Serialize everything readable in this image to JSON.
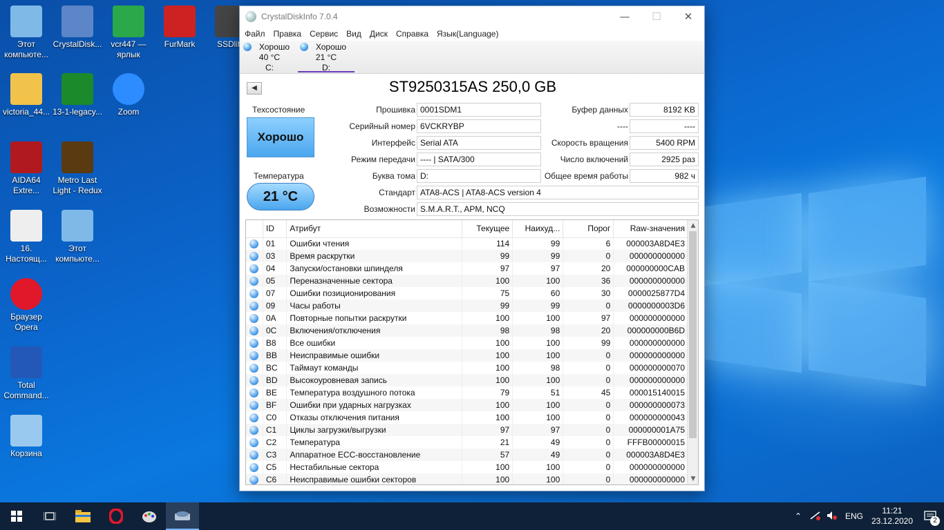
{
  "desktop": {
    "icons": [
      {
        "label": "Этот компьюте...",
        "icon": "computer-icon"
      },
      {
        "label": "CrystalDisk...",
        "icon": "crystaldisk-icon"
      },
      {
        "label": "vcr447 — ярлык",
        "icon": "vcr-icon"
      },
      {
        "label": "FurMark",
        "icon": "furmark-icon"
      },
      {
        "label": "SSDlife",
        "icon": "ssdlife-icon"
      },
      {
        "label": "victoria_44...",
        "icon": "folder-icon"
      },
      {
        "label": "13-1-legacy...",
        "icon": "amd-icon"
      },
      {
        "label": "Zoom",
        "icon": "zoom-icon"
      },
      {
        "label": "AIDA64 Extre...",
        "icon": "aida64-icon"
      },
      {
        "label": "Metro Last Light - Redux",
        "icon": "metro-icon"
      },
      {
        "label": "16. Настоящ...",
        "icon": "audio-file-icon"
      },
      {
        "label": "Этот компьюте...",
        "icon": "computer-icon"
      },
      {
        "label": "Браузер Opera",
        "icon": "opera-icon"
      },
      {
        "label": "Total Command...",
        "icon": "total-commander-icon"
      },
      {
        "label": "Корзина",
        "icon": "recycle-bin-icon"
      }
    ]
  },
  "window": {
    "title": "CrystalDiskInfo 7.0.4",
    "menu": [
      "Файл",
      "Правка",
      "Сервис",
      "Вид",
      "Диск",
      "Справка",
      "Язык(Language)"
    ],
    "disks": [
      {
        "status": "Хорошо",
        "temp": "40 °C",
        "letter": "C:"
      },
      {
        "status": "Хорошо",
        "temp": "21 °C",
        "letter": "D:"
      }
    ],
    "model": "ST9250315AS 250,0 GB",
    "health_label": "Техсостояние",
    "health_value": "Хорошо",
    "temp_label": "Температура",
    "temp_value": "21 °C",
    "fields": {
      "firmware_label": "Прошивка",
      "firmware": "0001SDM1",
      "serial_label": "Серийный номер",
      "serial": "6VCKRYBP",
      "interface_label": "Интерфейс",
      "interface": "Serial ATA",
      "transfer_label": "Режим передачи",
      "transfer": "---- | SATA/300",
      "letter_label": "Буква тома",
      "letter": "D:",
      "standard_label": "Стандарт",
      "standard": "ATA8-ACS | ATA8-ACS version 4",
      "features_label": "Возможности",
      "features": "S.M.A.R.T., APM, NCQ",
      "buffer_label": "Буфер данных",
      "buffer": "8192 KB",
      "blank_label": "----",
      "blank": "----",
      "rpm_label": "Скорость вращения",
      "rpm": "5400 RPM",
      "power_count_label": "Число включений",
      "power_count": "2925 раз",
      "power_hours_label": "Общее время работы",
      "power_hours": "982 ч"
    },
    "table": {
      "headers": [
        "ID",
        "Атрибут",
        "Текущее",
        "Наихуд...",
        "Порог",
        "Raw-значения"
      ],
      "rows": [
        [
          "01",
          "Ошибки чтения",
          "114",
          "99",
          "6",
          "000003A8D4E3"
        ],
        [
          "03",
          "Время раскрутки",
          "99",
          "99",
          "0",
          "000000000000"
        ],
        [
          "04",
          "Запуски/остановки шпинделя",
          "97",
          "97",
          "20",
          "000000000CAB"
        ],
        [
          "05",
          "Переназначенные сектора",
          "100",
          "100",
          "36",
          "000000000000"
        ],
        [
          "07",
          "Ошибки позиционирования",
          "75",
          "60",
          "30",
          "0000025877D4"
        ],
        [
          "09",
          "Часы работы",
          "99",
          "99",
          "0",
          "0000000003D6"
        ],
        [
          "0A",
          "Повторные попытки раскрутки",
          "100",
          "100",
          "97",
          "000000000000"
        ],
        [
          "0C",
          "Включения/отключения",
          "98",
          "98",
          "20",
          "000000000B6D"
        ],
        [
          "B8",
          "Все ошибки",
          "100",
          "100",
          "99",
          "000000000000"
        ],
        [
          "BB",
          "Неисправимые ошибки",
          "100",
          "100",
          "0",
          "000000000000"
        ],
        [
          "BC",
          "Таймаут команды",
          "100",
          "98",
          "0",
          "000000000070"
        ],
        [
          "BD",
          "Высокоуровневая запись",
          "100",
          "100",
          "0",
          "000000000000"
        ],
        [
          "BE",
          "Температура воздушного потока",
          "79",
          "51",
          "45",
          "000015140015"
        ],
        [
          "BF",
          "Ошибки при ударных нагрузках",
          "100",
          "100",
          "0",
          "000000000073"
        ],
        [
          "C0",
          "Отказы отключения питания",
          "100",
          "100",
          "0",
          "000000000043"
        ],
        [
          "C1",
          "Циклы загрузки/выгрузки",
          "97",
          "97",
          "0",
          "000000001A75"
        ],
        [
          "C2",
          "Температура",
          "21",
          "49",
          "0",
          "FFFB00000015"
        ],
        [
          "C3",
          "Аппаратное ECC-восстановление",
          "57",
          "49",
          "0",
          "000003A8D4E3"
        ],
        [
          "C5",
          "Нестабильные сектора",
          "100",
          "100",
          "0",
          "000000000000"
        ],
        [
          "C6",
          "Неисправимые ошибки секторов",
          "100",
          "100",
          "0",
          "000000000000"
        ]
      ]
    }
  },
  "taskbar": {
    "language": "ENG",
    "time": "11:21",
    "date": "23.12.2020",
    "notifications": "2"
  },
  "colors": {
    "desktop_bg": "#0b63c9",
    "taskbar_bg": "#0f2138",
    "health_good": "#4aa6ee"
  }
}
